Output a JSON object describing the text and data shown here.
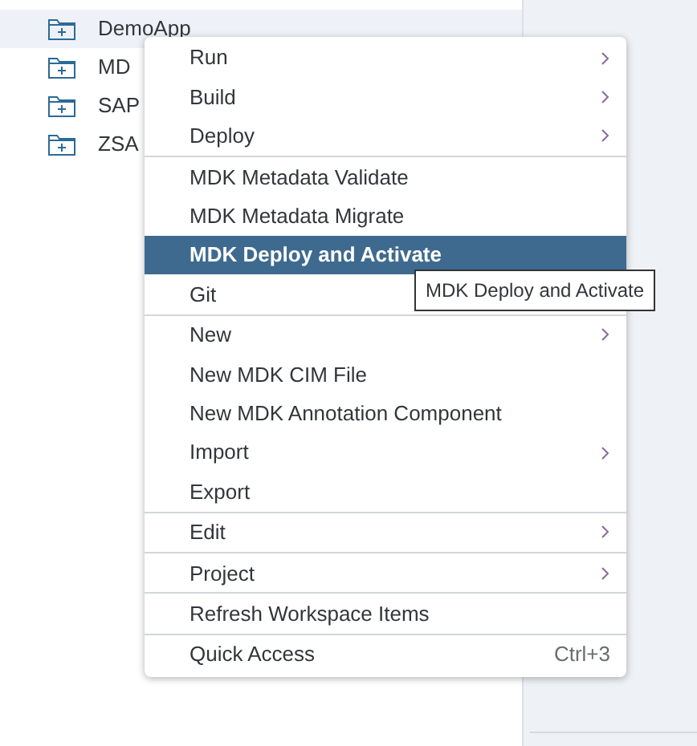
{
  "tree": {
    "items": [
      {
        "label": "DemoApp",
        "selected": true
      },
      {
        "label": "MD",
        "selected": false
      },
      {
        "label": "SAP",
        "selected": false
      },
      {
        "label": "ZSA",
        "selected": false
      }
    ]
  },
  "context_menu": {
    "groups": [
      [
        {
          "label": "Run",
          "submenu": true,
          "selected": false
        },
        {
          "label": "Build",
          "submenu": true,
          "selected": false
        },
        {
          "label": "Deploy",
          "submenu": true,
          "selected": false
        }
      ],
      [
        {
          "label": "MDK Metadata Validate",
          "submenu": false,
          "selected": false
        },
        {
          "label": "MDK Metadata Migrate",
          "submenu": false,
          "selected": false
        },
        {
          "label": "MDK Deploy and Activate",
          "submenu": false,
          "selected": true
        },
        {
          "label": "Git",
          "submenu": false,
          "selected": false
        }
      ],
      [
        {
          "label": "New",
          "submenu": true,
          "selected": false
        },
        {
          "label": "New MDK CIM File",
          "submenu": false,
          "selected": false
        },
        {
          "label": "New MDK Annotation Component",
          "submenu": false,
          "selected": false
        },
        {
          "label": "Import",
          "submenu": true,
          "selected": false
        },
        {
          "label": "Export",
          "submenu": false,
          "selected": false
        }
      ],
      [
        {
          "label": "Edit",
          "submenu": true,
          "selected": false
        }
      ],
      [
        {
          "label": "Project",
          "submenu": true,
          "selected": false
        }
      ],
      [
        {
          "label": "Refresh Workspace Items",
          "submenu": false,
          "selected": false
        }
      ],
      [
        {
          "label": "Quick Access",
          "submenu": false,
          "shortcut": "Ctrl+3",
          "selected": false
        }
      ]
    ]
  },
  "tooltip": {
    "text": "MDK Deploy and Activate"
  }
}
